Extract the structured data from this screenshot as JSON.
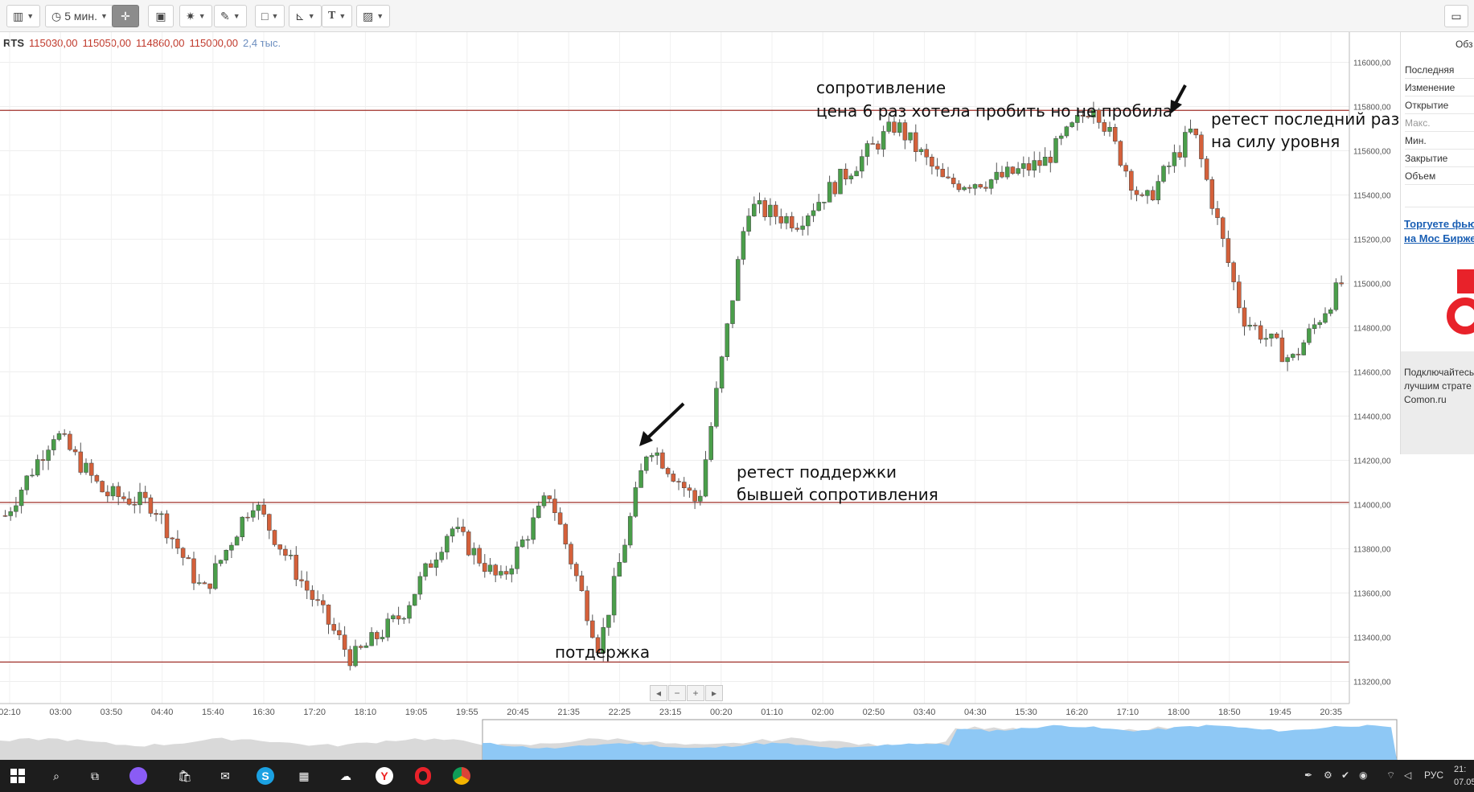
{
  "toolbar": {
    "timeframe": "5 мин.",
    "text_tool_label": "T"
  },
  "ticker": {
    "symbol": "RTS",
    "open": "115030,00",
    "high": "115050,00",
    "low": "114860,00",
    "close": "115000,00",
    "volume": "2,4 тыс."
  },
  "colors": {
    "up": "#4a9e4a",
    "down": "#d4603a",
    "level_line": "#a0302a",
    "price_tag": "#c0181e",
    "volume_fill": "#8ec8f5"
  },
  "chart_data": {
    "type": "candlestick",
    "symbol": "RTS",
    "timeframe": "5 мин.",
    "ylim": [
      113100,
      116100
    ],
    "y_ticks": [
      "116000,00",
      "115800,00",
      "115600,00",
      "115400,00",
      "115200,00",
      "115000,00",
      "114800,00",
      "114600,00",
      "114400,00",
      "114200,00",
      "114000,00",
      "113800,00",
      "113600,00",
      "113400,00",
      "113200,00"
    ],
    "x_ticks": [
      "02:10",
      "03:00",
      "03:50",
      "04:40",
      "15:40",
      "16:30",
      "17:20",
      "18:10",
      "19:05",
      "19:55",
      "20:45",
      "21:35",
      "22:25",
      "23:15",
      "00:20",
      "01:10",
      "02:00",
      "02:50",
      "03:40",
      "04:30",
      "15:30",
      "16:20",
      "17:10",
      "18:00",
      "18:50",
      "19:45",
      "20:35"
    ],
    "levels": [
      {
        "label": "115782,74",
        "value": 115782.74
      },
      {
        "label": "114009,52",
        "value": 114009.52
      },
      {
        "label": "113287,64",
        "value": 113287.64
      }
    ],
    "last_price": {
      "label": "115000,00",
      "value": 115000
    },
    "close_path": [
      {
        "t": "02:10",
        "v": 113950
      },
      {
        "t": "03:00",
        "v": 114330
      },
      {
        "t": "03:50",
        "v": 114050
      },
      {
        "t": "04:40",
        "v": 114000
      },
      {
        "t": "15:40",
        "v": 113600
      },
      {
        "t": "15:50",
        "v": 114020
      },
      {
        "t": "16:30",
        "v": 113650
      },
      {
        "t": "17:20",
        "v": 113300
      },
      {
        "t": "18:10",
        "v": 113500
      },
      {
        "t": "19:05",
        "v": 113900
      },
      {
        "t": "19:55",
        "v": 113650
      },
      {
        "t": "20:45",
        "v": 114050
      },
      {
        "t": "21:35",
        "v": 113350
      },
      {
        "t": "22:25",
        "v": 114280
      },
      {
        "t": "23:15",
        "v": 114000
      },
      {
        "t": "00:20",
        "v": 115350
      },
      {
        "t": "01:10",
        "v": 115280
      },
      {
        "t": "02:00",
        "v": 115500
      },
      {
        "t": "02:50",
        "v": 115720
      },
      {
        "t": "03:40",
        "v": 115450
      },
      {
        "t": "04:30",
        "v": 115470
      },
      {
        "t": "15:30",
        "v": 115550
      },
      {
        "t": "16:20",
        "v": 115820
      },
      {
        "t": "17:10",
        "v": 115350
      },
      {
        "t": "18:00",
        "v": 115700
      },
      {
        "t": "18:50",
        "v": 114850
      },
      {
        "t": "19:45",
        "v": 114650
      },
      {
        "t": "20:35",
        "v": 115000
      }
    ],
    "annotations": [
      {
        "text": "сопротивление"
      },
      {
        "text": "цена 6 раз хотела пробить  но не пробила"
      },
      {
        "text": "ретест последний раз пробуют"
      },
      {
        "text": "на силу уровня"
      },
      {
        "text": "ретест поддержки"
      },
      {
        "text": "бывшей сопротивления"
      },
      {
        "text": "потдержка"
      }
    ]
  },
  "side_panel": {
    "title": "Обз",
    "rows": [
      "Последняя",
      "Изменение",
      "Открытие",
      "Макс.",
      "Мин.",
      "Закрытие",
      "Объем"
    ],
    "link_line1": "Торгуете фью",
    "link_line2": "на Мос Бирже",
    "promo_line1": "Подключайтесь",
    "promo_line2": "лучшим страте",
    "promo_line3": "Comon.ru"
  },
  "nav_controls": [
    "◂",
    "−",
    "+",
    "▸"
  ],
  "taskbar": {
    "lang": "РУС",
    "time": "21:",
    "date": "07.05"
  }
}
